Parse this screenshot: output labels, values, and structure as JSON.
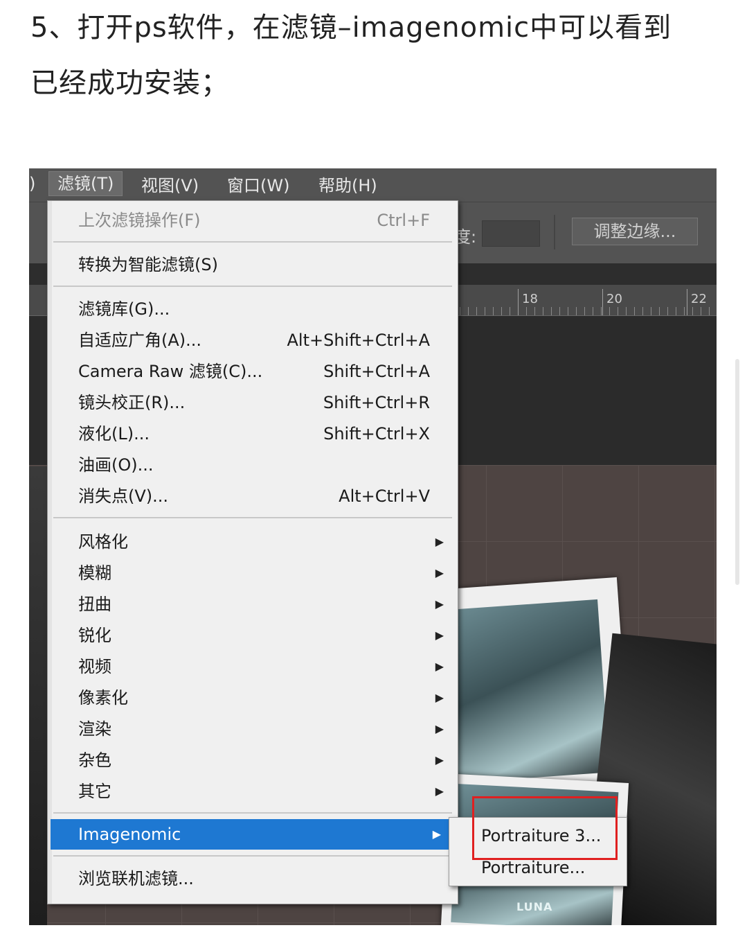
{
  "article": {
    "line1": "5、打开ps软件，在滤镜–imagenomic中可以看到",
    "line2": "已经成功安装；"
  },
  "screenshot": {
    "menubar": {
      "left_fragment": ")",
      "items": [
        {
          "label": "滤镜(T)",
          "active": true
        },
        {
          "label": "视图(V)"
        },
        {
          "label": "窗口(W)"
        },
        {
          "label": "帮助(H)"
        }
      ]
    },
    "options_bar": {
      "label": "度:",
      "refine_edge_button": "调整边缘..."
    },
    "ruler": {
      "labels": [
        "18",
        "20",
        "22"
      ]
    },
    "canvas": {
      "poster_text": "LUNA"
    },
    "filter_menu": {
      "items": [
        {
          "label": "上次滤镜操作(F)",
          "shortcut": "Ctrl+F",
          "disabled": true
        },
        {
          "label": "转换为智能滤镜(S)",
          "shortcut": ""
        },
        {
          "label": "滤镜库(G)...",
          "shortcut": ""
        },
        {
          "label": "自适应广角(A)...",
          "shortcut": "Alt+Shift+Ctrl+A"
        },
        {
          "label": "Camera Raw 滤镜(C)...",
          "shortcut": "Shift+Ctrl+A"
        },
        {
          "label": "镜头校正(R)...",
          "shortcut": "Shift+Ctrl+R"
        },
        {
          "label": "液化(L)...",
          "shortcut": "Shift+Ctrl+X"
        },
        {
          "label": "油画(O)...",
          "shortcut": ""
        },
        {
          "label": "消失点(V)...",
          "shortcut": "Alt+Ctrl+V"
        },
        {
          "label": "风格化",
          "submenu": true
        },
        {
          "label": "模糊",
          "submenu": true
        },
        {
          "label": "扭曲",
          "submenu": true
        },
        {
          "label": "锐化",
          "submenu": true
        },
        {
          "label": "视频",
          "submenu": true
        },
        {
          "label": "像素化",
          "submenu": true
        },
        {
          "label": "渲染",
          "submenu": true
        },
        {
          "label": "杂色",
          "submenu": true
        },
        {
          "label": "其它",
          "submenu": true
        },
        {
          "label": "Imagenomic",
          "submenu": true,
          "highlighted": true
        },
        {
          "label": "浏览联机滤镜...",
          "shortcut": ""
        }
      ],
      "submenu_arrow": "▶"
    },
    "imagenomic_submenu": {
      "items": [
        {
          "label": "Portraiture 3...",
          "annotated": true
        },
        {
          "label": "Portraiture..."
        }
      ]
    },
    "colors": {
      "menu_highlight": "#1e78d2",
      "annotation_box": "#e02020"
    }
  }
}
